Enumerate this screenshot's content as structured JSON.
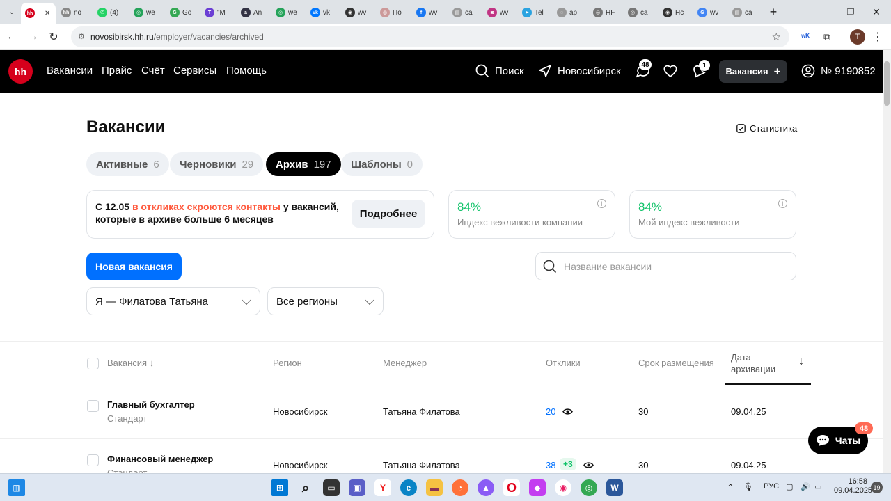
{
  "browser": {
    "tabs": [
      {
        "label": "",
        "color": "#d6001c",
        "glyph": "hh",
        "active": true
      },
      {
        "label": "no",
        "color": "#888",
        "glyph": "hh"
      },
      {
        "label": "(4)",
        "color": "#25d366",
        "glyph": "✆"
      },
      {
        "label": "we",
        "color": "#25a35a",
        "glyph": "◎"
      },
      {
        "label": "Go",
        "color": "#34a853",
        "glyph": "G"
      },
      {
        "label": "\"M",
        "color": "#6b3fd4",
        "glyph": "T"
      },
      {
        "label": "An",
        "color": "#334",
        "glyph": "a"
      },
      {
        "label": "we",
        "color": "#25a35a",
        "glyph": "◎"
      },
      {
        "label": "vk",
        "color": "#0077ff",
        "glyph": "vk"
      },
      {
        "label": "wv",
        "color": "#333",
        "glyph": "◉"
      },
      {
        "label": "По",
        "color": "#c99",
        "glyph": "◍"
      },
      {
        "label": "wv",
        "color": "#1877f2",
        "glyph": "f"
      },
      {
        "label": "ca",
        "color": "#999",
        "glyph": "▤"
      },
      {
        "label": "wv",
        "color": "#c13584",
        "glyph": "◙"
      },
      {
        "label": "Tel",
        "color": "#2aa3e0",
        "glyph": "➤"
      },
      {
        "label": "ap",
        "color": "#999",
        "glyph": "◌"
      },
      {
        "label": "HF",
        "color": "#777",
        "glyph": "◎"
      },
      {
        "label": "ca",
        "color": "#777",
        "glyph": "◎"
      },
      {
        "label": "Hc",
        "color": "#333",
        "glyph": "◉"
      },
      {
        "label": "wv",
        "color": "#4285f4",
        "glyph": "G"
      },
      {
        "label": "ca",
        "color": "#999",
        "glyph": "▤"
      }
    ],
    "url_host": "novosibirsk.hh.ru",
    "url_path": "/employer/vacancies/archived",
    "profile_initial": "T"
  },
  "header": {
    "logo": "hh",
    "nav": [
      "Вакансии",
      "Прайс",
      "Счёт",
      "Сервисы",
      "Помощь"
    ],
    "search_label": "Поиск",
    "city": "Новосибирск",
    "messages_count": "48",
    "notifications_count": "1",
    "vacancy_button": "Вакансия",
    "account": "№ 9190852"
  },
  "page": {
    "title": "Вакансии",
    "statistics_label": "Статистика",
    "tabs": [
      {
        "label": "Активные",
        "count": "6"
      },
      {
        "label": "Черновики",
        "count": "29"
      },
      {
        "label": "Архив",
        "count": "197"
      },
      {
        "label": "Шаблоны",
        "count": "0"
      }
    ],
    "notice": {
      "before": "С 12.05 ",
      "highlight": "в откликах скроются контакты",
      "after": " у вакансий, которые в архиве больше 6 месяцев",
      "button": "Подробнее"
    },
    "politeness_company": {
      "value": "84%",
      "label": "Индекс вежливости компании"
    },
    "politeness_mine": {
      "value": "84%",
      "label": "Мой индекс вежливости"
    },
    "new_vacancy_button": "Новая вакансия",
    "search_placeholder": "Название вакансии",
    "manager_filter": "Я — Филатова Татьяна",
    "region_filter": "Все регионы"
  },
  "table": {
    "columns": {
      "vacancy": "Вакансия",
      "region": "Регион",
      "manager": "Менеджер",
      "responses": "Отклики",
      "term": "Срок размещения",
      "archive_date": "Дата архивации"
    },
    "rows": [
      {
        "title": "Главный бухгалтер",
        "type": "Стандарт",
        "region": "Новосибирск",
        "manager": "Татьяна Филатова",
        "responses": "20",
        "new": "",
        "term": "30",
        "date": "09.04.25"
      },
      {
        "title": "Финансовый менеджер",
        "type": "Стандарт",
        "region": "Новосибирск",
        "manager": "Татьяна Филатова",
        "responses": "38",
        "new": "+3",
        "term": "30",
        "date": "09.04.25"
      }
    ]
  },
  "chats": {
    "label": "Чаты",
    "count": "48"
  },
  "taskbar": {
    "language": "РУС",
    "time": "16:58",
    "date": "09.04.2025",
    "notifications": "19"
  }
}
